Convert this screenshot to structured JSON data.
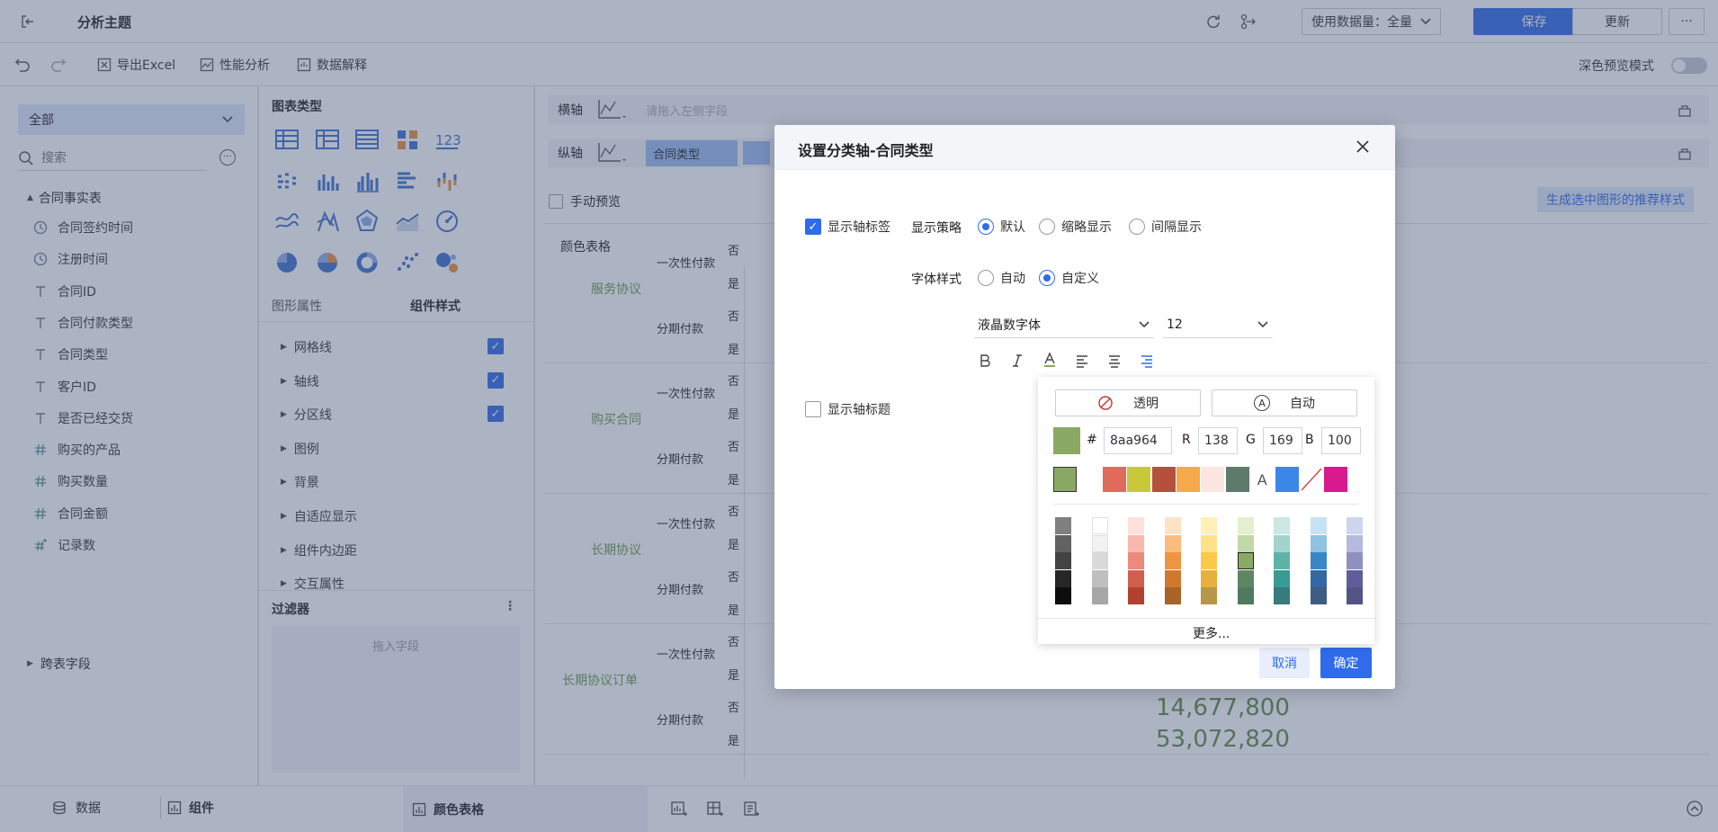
{
  "header": {
    "title": "分析主题",
    "data_volume_label": "使用数据量：全量",
    "save": "保存",
    "update": "更新",
    "more": "···"
  },
  "toolbar": {
    "export": "导出Excel",
    "perf": "性能分析",
    "explain": "数据解释",
    "dark_preview": "深色预览模式"
  },
  "left": {
    "dropdown": "全部",
    "search_placeholder": "搜索",
    "table_name": "合同事实表",
    "fields": [
      {
        "name": "合同签约时间",
        "icon": "clock-icon"
      },
      {
        "name": "注册时间",
        "icon": "clock-icon"
      },
      {
        "name": "合同ID",
        "icon": "text-icon"
      },
      {
        "name": "合同付款类型",
        "icon": "text-icon"
      },
      {
        "name": "合同类型",
        "icon": "text-icon"
      },
      {
        "name": "客户ID",
        "icon": "text-icon"
      },
      {
        "name": "是否已经交货",
        "icon": "text-icon"
      },
      {
        "name": "购买的产品",
        "icon": "hash-icon"
      },
      {
        "name": "购买数量",
        "icon": "hash-icon"
      },
      {
        "name": "合同金额",
        "icon": "hash-icon"
      },
      {
        "name": "记录数",
        "icon": "hash-plus-icon"
      }
    ],
    "cross_table": "跨表字段"
  },
  "middle": {
    "chart_type_title": "图表类型",
    "tab_props": "图形属性",
    "tab_style": "组件样式",
    "props": [
      "网格线",
      "轴线",
      "分区线",
      "图例",
      "背景",
      "自适应显示",
      "组件内边距",
      "交互属性"
    ],
    "filter_title": "过滤器",
    "filter_drop": "拖入字段"
  },
  "right": {
    "x_axis": "横轴",
    "y_axis": "纵轴",
    "x_placeholder": "请拖入左侧字段",
    "y_field": "合同类型",
    "manual_preview": "手动预览",
    "recommend": "生成选中图形的推荐样式",
    "chart_title": "颜色表格",
    "groups": [
      "服务协议",
      "购买合同",
      "长期协议",
      "长期协议订单"
    ],
    "pay_types": [
      "一次性付款",
      "分期付款"
    ],
    "yes": "是",
    "no": "否",
    "values": [
      "14,677,800",
      "53,072,820"
    ]
  },
  "bottom": {
    "data": "数据",
    "component": "组件",
    "sheet": "颜色表格"
  },
  "modal": {
    "title": "设置分类轴-合同类型",
    "show_axis_label": "显示轴标签",
    "strategy_label": "显示策略",
    "strategy_opts": [
      "默认",
      "缩略显示",
      "间隔显示"
    ],
    "font_style_label": "字体样式",
    "font_opts": [
      "自动",
      "自定义"
    ],
    "font_family": "液晶数字体",
    "font_size": "12",
    "show_axis_title": "显示轴标题",
    "cancel": "取消",
    "ok": "确定"
  },
  "picker": {
    "transparent": "透明",
    "auto": "自动",
    "hash": "#",
    "hex": "8aa964",
    "r_label": "R",
    "r": "138",
    "g_label": "G",
    "g": "169",
    "b_label": "B",
    "b": "100",
    "more": "更多...",
    "letter": "A",
    "selected_color": "#8aa964",
    "recent": [
      "#8aa964",
      "#ffffff",
      "#e06b5b",
      "#c8c83a",
      "#b5503f",
      "#f5a94a",
      "#fde6e0",
      "#5d7a6a",
      "A",
      "#3a87e8",
      "none",
      "#d91a8f"
    ],
    "grid": [
      [
        "#7f7f7f",
        "#626262",
        "#434343",
        "#262626",
        "#0d0d0d"
      ],
      [
        "#ffffff",
        "#f2f2f2",
        "#d9d9d9",
        "#bfbfbf",
        "#a6a6a6"
      ],
      [
        "#fde0dc",
        "#f9b8ae",
        "#ec8a7c",
        "#d0604e",
        "#b0422f"
      ],
      [
        "#fde3c5",
        "#fbbc7e",
        "#ef9440",
        "#d2782c",
        "#a86428"
      ],
      [
        "#fff0b8",
        "#fde28a",
        "#fbc94a",
        "#e8b03a",
        "#b8964a"
      ],
      [
        "#e3efcf",
        "#c1d9a8",
        "#8aa964",
        "#5f8663",
        "#4e7a60"
      ],
      [
        "#cde7e2",
        "#a2d4cb",
        "#5fb2a6",
        "#3a9a94",
        "#377b7e"
      ],
      [
        "#c6e3f5",
        "#8fc3e3",
        "#3a87c8",
        "#3468a4",
        "#3f5c85"
      ],
      [
        "#cfd5ee",
        "#b4b9de",
        "#8f90bd",
        "#5f5e9a",
        "#545386"
      ]
    ]
  }
}
